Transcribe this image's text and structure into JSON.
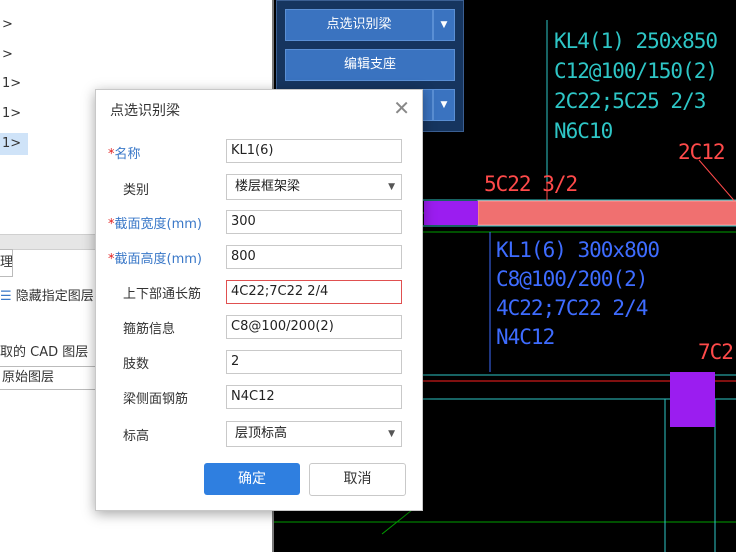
{
  "tree": {
    "rows": [
      ">",
      ">",
      "1>",
      "1>",
      "1>"
    ]
  },
  "left_panel": {
    "tab_fragment": "理",
    "hide_label": "隐藏指定图层",
    "cad_label": "取的 CAD 图层",
    "original_layer": "原始图层"
  },
  "toolbar": {
    "identify_beam_label": "点选识别梁",
    "edit_support_label": "编辑支座"
  },
  "dialog": {
    "title": "点选识别梁",
    "required_mark": "*",
    "fields": {
      "name": {
        "label": "名称",
        "value": "KL1(6)"
      },
      "category": {
        "label": "类别",
        "value": "楼层框架梁"
      },
      "width": {
        "label": "截面宽度(mm)",
        "value": "300"
      },
      "height": {
        "label": "截面高度(mm)",
        "value": "800"
      },
      "long_rebar": {
        "label": "上下部通长筋",
        "value": "4C22;7C22 2/4"
      },
      "stirrup": {
        "label": "箍筋信息",
        "value": "C8@100/200(2)"
      },
      "legs": {
        "label": "肢数",
        "value": "2"
      },
      "side_rebar": {
        "label": "梁侧面钢筋",
        "value": "N4C12"
      },
      "elevation": {
        "label": "标高",
        "value": "层顶标高"
      }
    },
    "ok_label": "确定",
    "cancel_label": "取消"
  },
  "cad": {
    "annotation_kl4": [
      "KL4(1) 250x850",
      "C12@100/150(2)",
      "2C22;5C25 2/3",
      "N6C10"
    ],
    "annotation_kl1": [
      "KL1(6) 300x800",
      "C8@100/200(2)",
      "4C22;7C22 2/4",
      "N4C12"
    ],
    "label_2c12": "2C12",
    "label_5c22": "5C22 3/2",
    "label_7c2": "7C2",
    "colors": {
      "background": "#000000",
      "text_cyan": "#2ec6c6",
      "text_blue": "#3e6cff",
      "text_red": "#ff4a4a",
      "beam_fill": "#f07070",
      "column_fill": "#9b1df0"
    }
  }
}
